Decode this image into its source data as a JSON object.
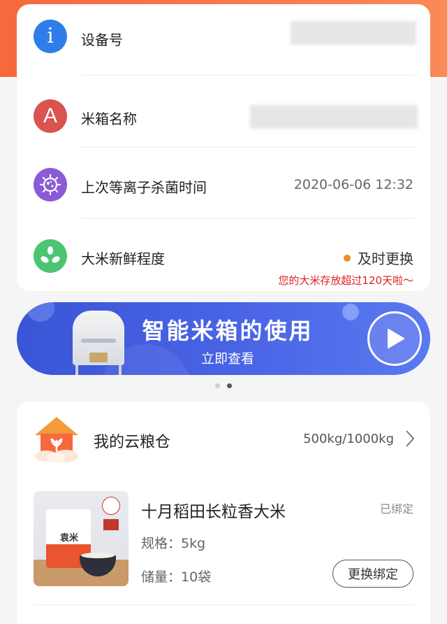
{
  "info": {
    "device_id_label": "设备号",
    "device_id_value": "",
    "box_name_label": "米箱名称",
    "box_name_value": "",
    "plasma_label": "上次等离子杀菌时间",
    "plasma_value": "2020-06-06 12:32",
    "freshness_label": "大米新鲜程度",
    "freshness_status": "及时更换",
    "freshness_warning": "您的大米存放超过120天啦～",
    "info_icon_glyph": "i",
    "name_icon_glyph": "A"
  },
  "colors": {
    "header": "#f7683c",
    "info_icon": "#2f7de8",
    "name_icon": "#d9534f",
    "plasma_icon": "#8b5bd6",
    "freshness_icon": "#4cc472",
    "status_dot": "#f08a2a",
    "warning_text": "#e02020",
    "banner": "#3f5ae0"
  },
  "banner": {
    "title": "智能米箱的使用",
    "subtitle": "立即查看",
    "play_icon": "play-icon"
  },
  "carousel": {
    "count": 2,
    "active_index": 1
  },
  "granary": {
    "title": "我的云粮仓",
    "capacity": "500kg/1000kg",
    "product": {
      "name": "十月稻田长粒香大米",
      "status": "已绑定",
      "spec_label": "规格：",
      "spec_value": "5kg",
      "stock_label": "储量：",
      "stock_value": "10袋",
      "rebind_label": "更换绑定",
      "package_brand": "袁米"
    }
  }
}
